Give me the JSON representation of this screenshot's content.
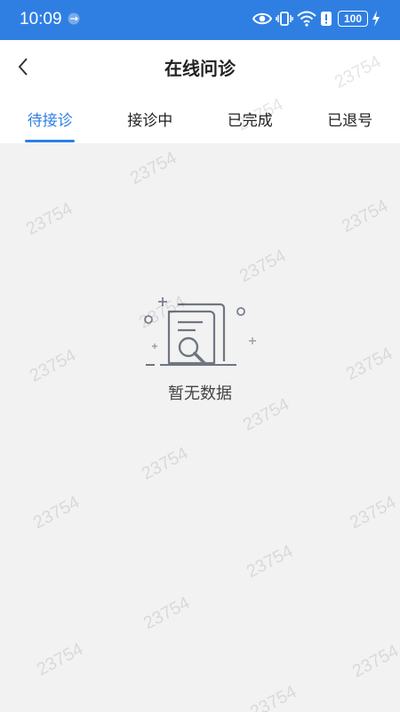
{
  "status_bar": {
    "time": "10:09",
    "battery": "100",
    "icons": [
      "usb-icon",
      "eye-icon",
      "vibrate-icon",
      "wifi-icon",
      "alert-icon",
      "battery-icon",
      "charging-icon"
    ]
  },
  "header": {
    "title": "在线问诊",
    "back_icon": "chevron-left-icon"
  },
  "tabs": [
    {
      "label": "待接诊",
      "active": true
    },
    {
      "label": "接诊中",
      "active": false
    },
    {
      "label": "已完成",
      "active": false
    },
    {
      "label": "已退号",
      "active": false
    }
  ],
  "empty_state": {
    "icon": "document-search-icon",
    "text": "暂无数据"
  },
  "watermark": {
    "text": "23754"
  },
  "colors": {
    "accent": "#2f7fe3",
    "background": "#f2f2f3"
  }
}
